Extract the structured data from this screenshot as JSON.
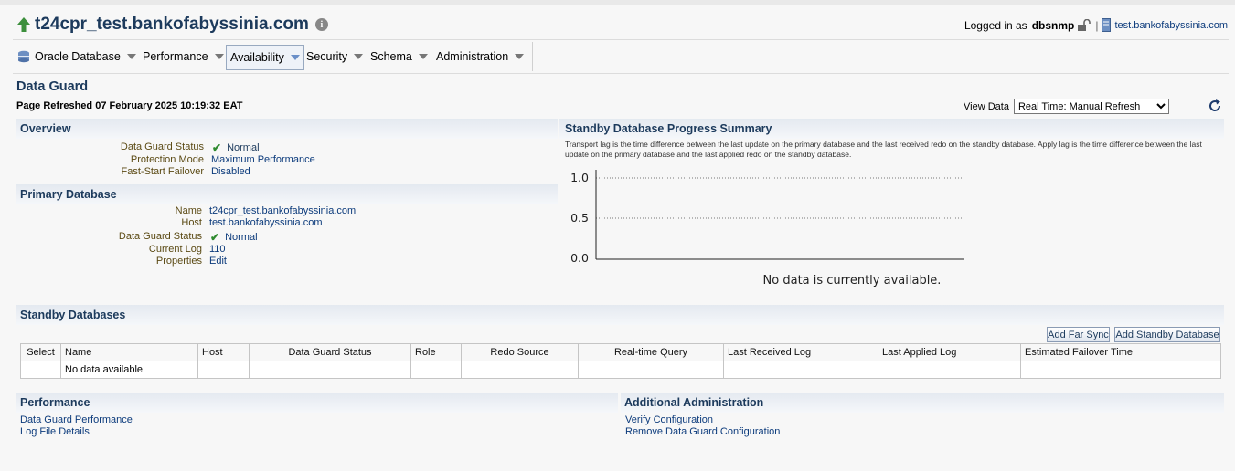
{
  "header": {
    "title": "t24cpr_test.bankofabyssinia.com",
    "logged_in_label": "Logged in as",
    "username": "dbsnmp",
    "separator": "|",
    "host_link": "test.bankofabyssinia.com"
  },
  "menu": {
    "items": [
      {
        "label": "Oracle Database",
        "icon": "database-icon"
      },
      {
        "label": "Performance"
      },
      {
        "label": "Availability",
        "active": true
      },
      {
        "label": "Security"
      },
      {
        "label": "Schema"
      },
      {
        "label": "Administration"
      }
    ]
  },
  "page": {
    "title": "Data Guard",
    "refreshed": "Page Refreshed 07 February 2025 10:19:32 EAT",
    "view_data_label": "View Data",
    "view_data_options": [
      "Real Time: Manual Refresh"
    ],
    "view_data_selected": "Real Time: Manual Refresh"
  },
  "overview": {
    "heading": "Overview",
    "rows": [
      {
        "label": "Data Guard Status",
        "value": "Normal",
        "status_icon": "check-icon"
      },
      {
        "label": "Protection Mode",
        "value": "Maximum Performance"
      },
      {
        "label": "Fast-Start Failover",
        "value": "Disabled"
      }
    ]
  },
  "primary": {
    "heading": "Primary Database",
    "rows": [
      {
        "label": "Name",
        "value": "t24cpr_test.bankofabyssinia.com"
      },
      {
        "label": "Host",
        "value": "test.bankofabyssinia.com"
      },
      {
        "label": "Data Guard Status",
        "value": "Normal",
        "status_icon": "check-icon"
      },
      {
        "label": "Current Log",
        "value": "110"
      },
      {
        "label": "Properties",
        "value": "Edit"
      }
    ]
  },
  "progress": {
    "heading": "Standby Database Progress Summary",
    "description": "Transport lag is the time difference between the last update on the primary database and the last received redo on the standby database. Apply lag is the time difference between the last update on the primary database and the last applied redo on the standby database.",
    "no_data": "No data is currently available.",
    "chart_data": {
      "type": "bar",
      "categories": [],
      "series": [],
      "ylim": [
        0.0,
        1.0
      ],
      "yticks": [
        "1.0",
        "0.5",
        "0.0"
      ],
      "grid": true
    }
  },
  "standby": {
    "heading": "Standby Databases",
    "add_far_sync": "Add Far Sync",
    "add_standby": "Add Standby Database",
    "columns": [
      "Select",
      "Name",
      "Host",
      "Data Guard Status",
      "Role",
      "Redo Source",
      "Real-time Query",
      "Last Received Log",
      "Last Applied Log",
      "Estimated Failover Time"
    ],
    "empty_text": "No data available"
  },
  "performance": {
    "heading": "Performance",
    "links": [
      "Data Guard Performance",
      "Log File Details"
    ]
  },
  "additional": {
    "heading": "Additional Administration",
    "links": [
      "Verify Configuration",
      "Remove Data Guard Configuration"
    ]
  },
  "colors": {
    "heading_text": "#1c3a5c",
    "link": "#0c3b7c",
    "label_text": "#5b4a14",
    "status_ok": "#2f8a2f",
    "up_arrow": "#3c8f3c"
  }
}
